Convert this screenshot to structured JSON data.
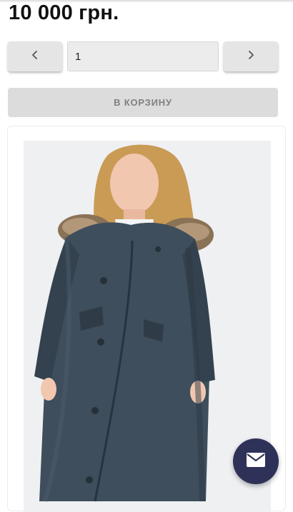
{
  "product": {
    "price": "10 000 грн."
  },
  "quantity": {
    "value": "1",
    "decrement_icon": "chevron-left-icon",
    "increment_icon": "chevron-right-icon"
  },
  "cart_button": {
    "label": "В КОРЗИНУ"
  },
  "photo": {
    "subject": "product-photo"
  },
  "fab": {
    "icon": "envelope-icon",
    "color": "#2e3158"
  },
  "colors": {
    "coat": "#3f4e5c",
    "button_bg": "#e5e5e5",
    "cart_bg": "#dcdcdc",
    "cart_text": "#808080"
  }
}
